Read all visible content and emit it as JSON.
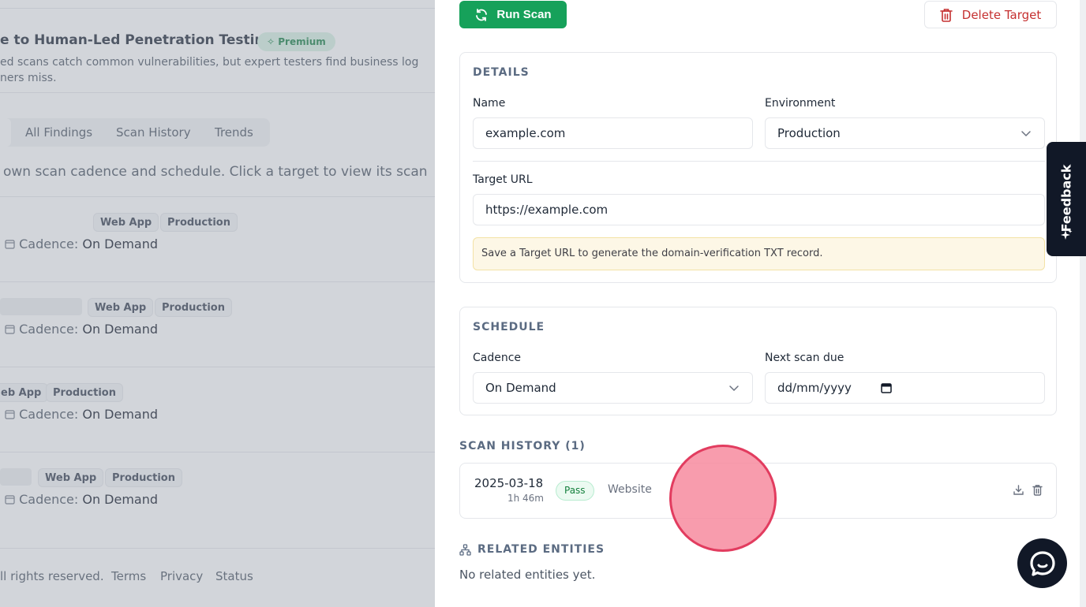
{
  "background": {
    "banner_title": "e to Human-Led Penetration Testing",
    "premium_badge": "Premium",
    "banner_desc": "ed scans catch common vulnerabilities, but expert testers find business log\nners miss.",
    "tabs": [
      "All Findings",
      "Scan History",
      "Trends"
    ],
    "intro": "own scan cadence and schedule. Click a target to view its scan",
    "targets": [
      {
        "type": "Web App",
        "env": "Production",
        "cadence_label": "Cadence:",
        "cadence_value": "On Demand"
      },
      {
        "type": "Web App",
        "env": "Production",
        "cadence_label": "Cadence:",
        "cadence_value": "On Demand"
      },
      {
        "type": "eb App",
        "env": "Production",
        "cadence_label": "Cadence:",
        "cadence_value": "On Demand"
      },
      {
        "type": "Web App",
        "env": "Production",
        "cadence_label": "Cadence:",
        "cadence_value": "On Demand"
      }
    ],
    "footer": {
      "copyright": "ll rights reserved.",
      "terms": "Terms",
      "privacy": "Privacy",
      "status": "Status"
    }
  },
  "drawer": {
    "run_scan": "Run Scan",
    "delete_target": "Delete Target",
    "details": {
      "title": "DETAILS",
      "name_label": "Name",
      "name_value": "example.com",
      "env_label": "Environment",
      "env_value": "Production",
      "url_label": "Target URL",
      "url_value": "https://example.com",
      "notice": "Save a Target URL to generate the domain-verification TXT record."
    },
    "schedule": {
      "title": "SCHEDULE",
      "cadence_label": "Cadence",
      "cadence_value": "On Demand",
      "next_label": "Next scan due",
      "next_placeholder": "dd/mm/yyyy"
    },
    "history": {
      "title": "SCAN HISTORY (1)",
      "rows": [
        {
          "date": "2025-03-18",
          "duration": "1h 46m",
          "result": "Pass",
          "type": "Website"
        }
      ]
    },
    "related": {
      "title": "RELATED ENTITIES",
      "empty": "No related entities yet."
    }
  },
  "feedback": "Feedback",
  "colors": {
    "primary": "#16a15a",
    "danger": "#c53030",
    "dark": "#111827",
    "click": "#e23c5f"
  },
  "icons": [
    "refresh-icon",
    "trash-icon",
    "chevron-down-icon",
    "calendar-icon",
    "download-icon",
    "sitemap-icon",
    "sparkle-icon",
    "chat-icon"
  ]
}
